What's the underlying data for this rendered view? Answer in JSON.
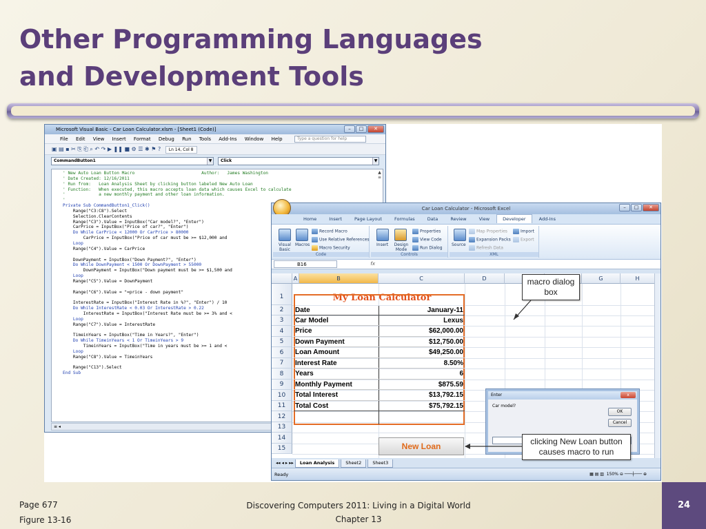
{
  "slide": {
    "title_line1": "Other Programming Languages",
    "title_line2": "and Development Tools",
    "footer_page": "Page 677",
    "footer_figure": "Figure 13-16",
    "footer_book": "Discovering Computers 2011: Living in a Digital World",
    "footer_chapter": "Chapter 13",
    "page_number": "24"
  },
  "vb": {
    "title": "Microsoft Visual Basic - Car Loan Calculator.xlsm - [Sheet1 (Code)]",
    "menu": [
      "File",
      "Edit",
      "View",
      "Insert",
      "Format",
      "Debug",
      "Run",
      "Tools",
      "Add-Ins",
      "Window",
      "Help"
    ],
    "help_placeholder": "Type a question for help",
    "position": "Ln 14, Col 8",
    "object_combo": "CommandButton1",
    "proc_combo": "Click",
    "code_lines": [
      {
        "t": "' New Auto Loan Button Macro                          Author:   James Washington",
        "k": "cm"
      },
      {
        "t": "' Date Created: 12/16/2011",
        "k": "cm"
      },
      {
        "t": "' Run from:   Loan Analysis Sheet by clicking button labeled New Auto Loan",
        "k": "cm"
      },
      {
        "t": "' Function:   When executed, this macro accepts loan data which causes Excel to calculate",
        "k": "cm"
      },
      {
        "t": "'             a new monthly payment and other loan information.",
        "k": "cm"
      },
      {
        "t": "'",
        "k": "cm"
      },
      {
        "t": "Private Sub CommandButton1_Click()",
        "k": "kw"
      },
      {
        "t": "    Range(\"C3:C8\").Select",
        "k": ""
      },
      {
        "t": "    Selection.ClearContents",
        "k": ""
      },
      {
        "t": "    Range(\"C3\").Value = InputBox(\"Car model?\", \"Enter\")",
        "k": ""
      },
      {
        "t": "    CarPrice = InputBox(\"Price of car?\", \"Enter\")",
        "k": ""
      },
      {
        "t": "    Do While CarPrice < 12000 Or CarPrice > 80000",
        "k": "kw"
      },
      {
        "t": "        CarPrice = InputBox(\"Price of car must be >= $12,000 and",
        "k": ""
      },
      {
        "t": "    Loop",
        "k": "kw"
      },
      {
        "t": "    Range(\"C4\").Value = CarPrice",
        "k": ""
      },
      {
        "t": "",
        "k": ""
      },
      {
        "t": "    DownPayment = InputBox(\"Down Payment?\", \"Enter\")",
        "k": ""
      },
      {
        "t": "    Do While DownPayment < 1500 Or DownPayment > 55000",
        "k": "kw"
      },
      {
        "t": "        DownPayment = InputBox(\"Down payment must be >= $1,500 and",
        "k": ""
      },
      {
        "t": "    Loop",
        "k": "kw"
      },
      {
        "t": "    Range(\"C5\").Value = DownPayment",
        "k": ""
      },
      {
        "t": "",
        "k": ""
      },
      {
        "t": "    Range(\"C6\").Value = \"=price - down payment\"",
        "k": ""
      },
      {
        "t": "",
        "k": ""
      },
      {
        "t": "    InterestRate = InputBox(\"Interest Rate in %?\", \"Enter\") / 10",
        "k": ""
      },
      {
        "t": "    Do While InterestRate < 0.03 Or InterestRate > 0.22",
        "k": "kw"
      },
      {
        "t": "        InterestRate = InputBox(\"Interest Rate must be >= 3% and <",
        "k": ""
      },
      {
        "t": "    Loop",
        "k": "kw"
      },
      {
        "t": "    Range(\"C7\").Value = InterestRate",
        "k": ""
      },
      {
        "t": "",
        "k": ""
      },
      {
        "t": "    TimeinYears = InputBox(\"Time in Years?\", \"Enter\")",
        "k": ""
      },
      {
        "t": "    Do While TimeinYears < 1 Or TimeinYears > 9",
        "k": "kw"
      },
      {
        "t": "        TimeinYears = InputBox(\"Time in years must be >= 1 and <",
        "k": ""
      },
      {
        "t": "    Loop",
        "k": "kw"
      },
      {
        "t": "    Range(\"C8\").Value = TimeinYears",
        "k": ""
      },
      {
        "t": "",
        "k": ""
      },
      {
        "t": "    Range(\"C13\").Select",
        "k": ""
      },
      {
        "t": "End Sub",
        "k": "kw"
      }
    ]
  },
  "excel": {
    "title": "Car Loan Calculator - Microsoft Excel",
    "tabs": [
      "Home",
      "Insert",
      "Page Layout",
      "Formulas",
      "Data",
      "Review",
      "View",
      "Developer",
      "Add-Ins"
    ],
    "active_tab": "Developer",
    "ribbon": {
      "visual_basic": "Visual Basic",
      "macros": "Macros",
      "record_macro": "Record Macro",
      "use_relative": "Use Relative References",
      "macro_security": "Macro Security",
      "group_code": "Code",
      "insert": "Insert",
      "design_mode": "Design Mode",
      "properties": "Properties",
      "view_code": "View Code",
      "run_dialog": "Run Dialog",
      "group_controls": "Controls",
      "source": "Source",
      "map_properties": "Map Properties",
      "expansion_packs": "Expansion Packs",
      "refresh_data": "Refresh Data",
      "import": "Import",
      "export": "Export",
      "group_xml": "XML"
    },
    "name_box": "B16",
    "fx": "fx",
    "columns": [
      "A",
      "B",
      "C",
      "D",
      "E",
      "F",
      "G",
      "H"
    ],
    "rows": [
      "1",
      "2",
      "3",
      "4",
      "5",
      "6",
      "7",
      "8",
      "9",
      "10",
      "11",
      "12",
      "13",
      "14",
      "15"
    ],
    "table_title": "My Loan Calculator",
    "table": [
      {
        "label": "Date",
        "value": "January-11"
      },
      {
        "label": "Car Model",
        "value": "Lexus"
      },
      {
        "label": "Price",
        "value": "$62,000.00"
      },
      {
        "label": "Down Payment",
        "value": "$12,750.00"
      },
      {
        "label": "Loan Amount",
        "value": "$49,250.00"
      },
      {
        "label": "Interest Rate",
        "value": "8.50%"
      },
      {
        "label": "Years",
        "value": "6"
      },
      {
        "label": "Monthly Payment",
        "value": "$875.59"
      },
      {
        "label": "Total Interest",
        "value": "$13,792.15"
      },
      {
        "label": "Total Cost",
        "value": "$75,792.15"
      }
    ],
    "new_loan_button": "New Loan",
    "dialog": {
      "title": "Enter",
      "prompt": "Car model?",
      "ok": "OK",
      "cancel": "Cancel",
      "close": "x",
      "value": ""
    },
    "sheet_tabs": [
      "Loan Analysis",
      "Sheet2",
      "Sheet3"
    ],
    "status": "Ready",
    "zoom": "150%"
  },
  "callouts": {
    "macro_dialog": "macro dialog box",
    "clicking": "clicking New Loan button causes macro to run"
  }
}
